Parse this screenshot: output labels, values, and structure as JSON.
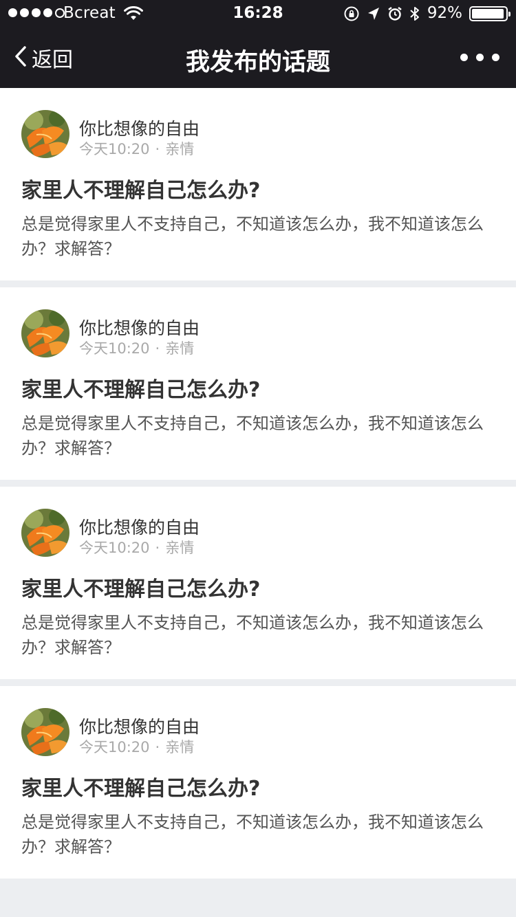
{
  "status_bar": {
    "carrier": "Bcreat",
    "time": "16:28",
    "battery_percent": "92%"
  },
  "nav": {
    "back_label": "返回",
    "title": "我发布的话题"
  },
  "topics": [
    {
      "author": "你比想像的自由",
      "time": "今天10:20",
      "separator": "·",
      "category": "亲情",
      "title": "家里人不理解自己怎么办?",
      "body": "总是觉得家里人不支持自己，不知道该怎么办，我不知道该怎么办？求解答？"
    },
    {
      "author": "你比想像的自由",
      "time": "今天10:20",
      "separator": "·",
      "category": "亲情",
      "title": "家里人不理解自己怎么办?",
      "body": "总是觉得家里人不支持自己，不知道该怎么办，我不知道该怎么办？求解答？"
    },
    {
      "author": "你比想像的自由",
      "time": "今天10:20",
      "separator": "·",
      "category": "亲情",
      "title": "家里人不理解自己怎么办?",
      "body": "总是觉得家里人不支持自己，不知道该怎么办，我不知道该怎么办？求解答？"
    },
    {
      "author": "你比想像的自由",
      "time": "今天10:20",
      "separator": "·",
      "category": "亲情",
      "title": "家里人不理解自己怎么办?",
      "body": "总是觉得家里人不支持自己，不知道该怎么办，我不知道该怎么办？求解答？"
    }
  ],
  "icons": {
    "back": "chevron-left-icon",
    "more": "more-dots-icon",
    "wifi": "wifi-icon",
    "orientation_lock": "orientation-lock-icon",
    "location": "location-arrow-icon",
    "alarm": "alarm-icon",
    "bluetooth": "bluetooth-icon",
    "battery": "battery-icon"
  },
  "colors": {
    "header_bg": "#1c1b20",
    "page_bg": "#eceef1",
    "card_bg": "#ffffff",
    "title_text": "#333333",
    "body_text": "#555555",
    "meta_text": "#a9a9a9"
  }
}
